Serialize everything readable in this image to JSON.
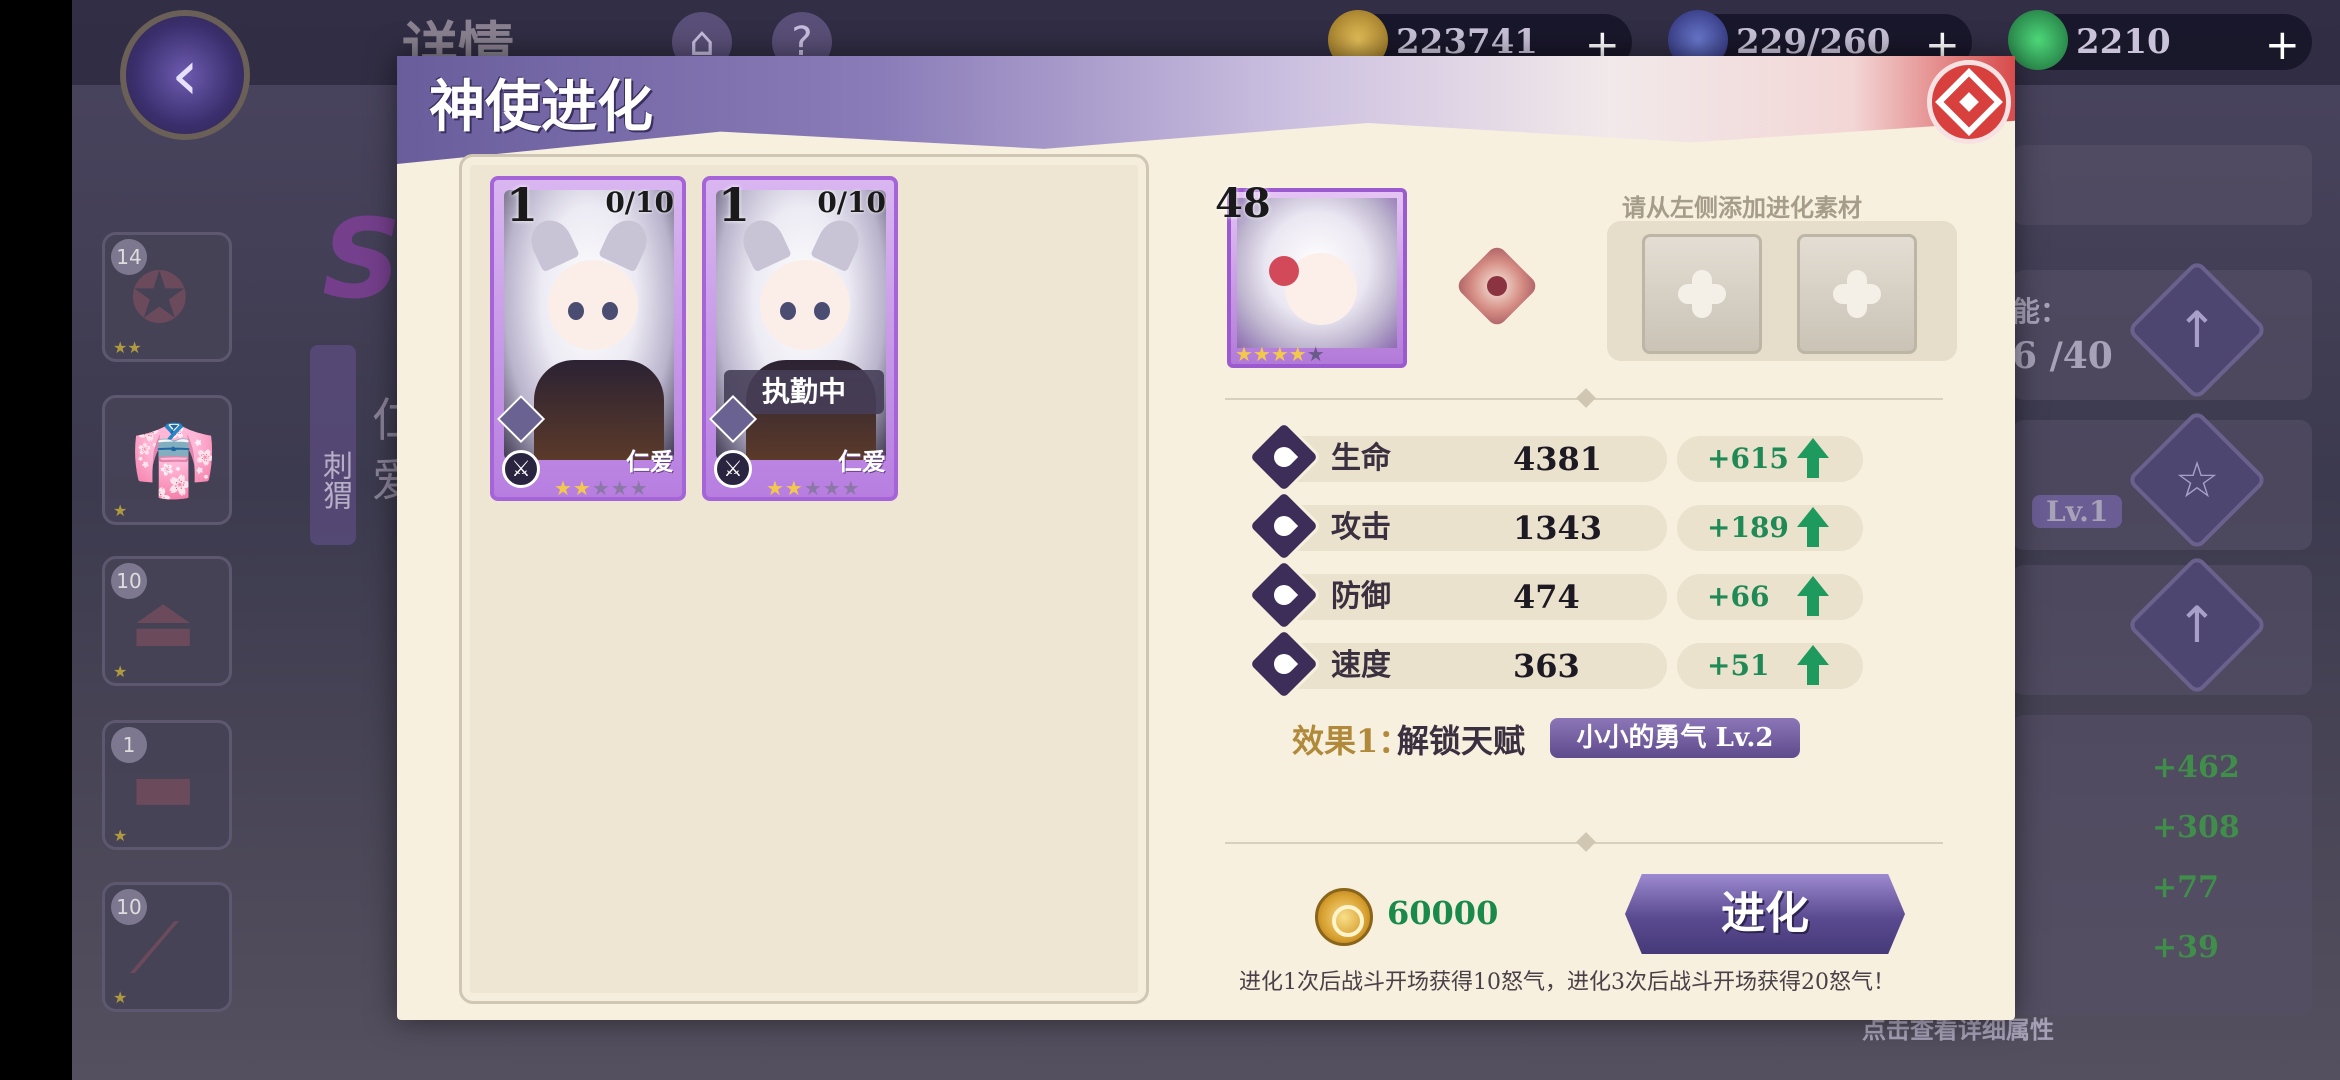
{
  "background": {
    "title": "详情",
    "resources": {
      "gold": "223741",
      "energy": "229/260",
      "gems": "2210"
    },
    "left_items": [
      {
        "count": "14"
      },
      {
        "count": ""
      },
      {
        "count": "10"
      },
      {
        "count": "1"
      },
      {
        "count": "10"
      }
    ],
    "side_label": "刺猬",
    "name_fragment": "仁\n爱",
    "right_texts": {
      "ability": "能：",
      "progress": "6 /40",
      "level": "Lv.1"
    },
    "right_bonuses": [
      "+462",
      "+308",
      "+77",
      "+39"
    ],
    "bottom_hint": "点击查看详细属性"
  },
  "modal": {
    "title": "神使进化",
    "materials": [
      {
        "level": "1",
        "count": "0/10",
        "tag": "仁爱",
        "stars_on": 2,
        "stars_total": 5,
        "status": ""
      },
      {
        "level": "1",
        "count": "0/10",
        "tag": "仁爱",
        "stars_on": 2,
        "stars_total": 5,
        "status": "执勤中"
      }
    ],
    "hero": {
      "level": "48",
      "stars_on": 4,
      "stars_total": 5
    },
    "hint": "请从左侧添加进化素材",
    "stats": [
      {
        "name": "生命",
        "value": "4381",
        "bonus": "+615"
      },
      {
        "name": "攻击",
        "value": "1343",
        "bonus": "+189"
      },
      {
        "name": "防御",
        "value": "474",
        "bonus": "+66"
      },
      {
        "name": "速度",
        "value": "363",
        "bonus": "+51"
      }
    ],
    "effect": {
      "label": "效果1：",
      "text": "解锁天赋",
      "talent": "小小的勇气  Lv.2"
    },
    "cost": "60000",
    "evolve_label": "进化",
    "footnote": "进化1次后战斗开场获得10怒气，进化3次后战斗开场获得20怒气！"
  },
  "colors": {
    "accent": "#5a4a90",
    "bonus_green": "#1f8a56",
    "close_red": "#d8403e"
  }
}
